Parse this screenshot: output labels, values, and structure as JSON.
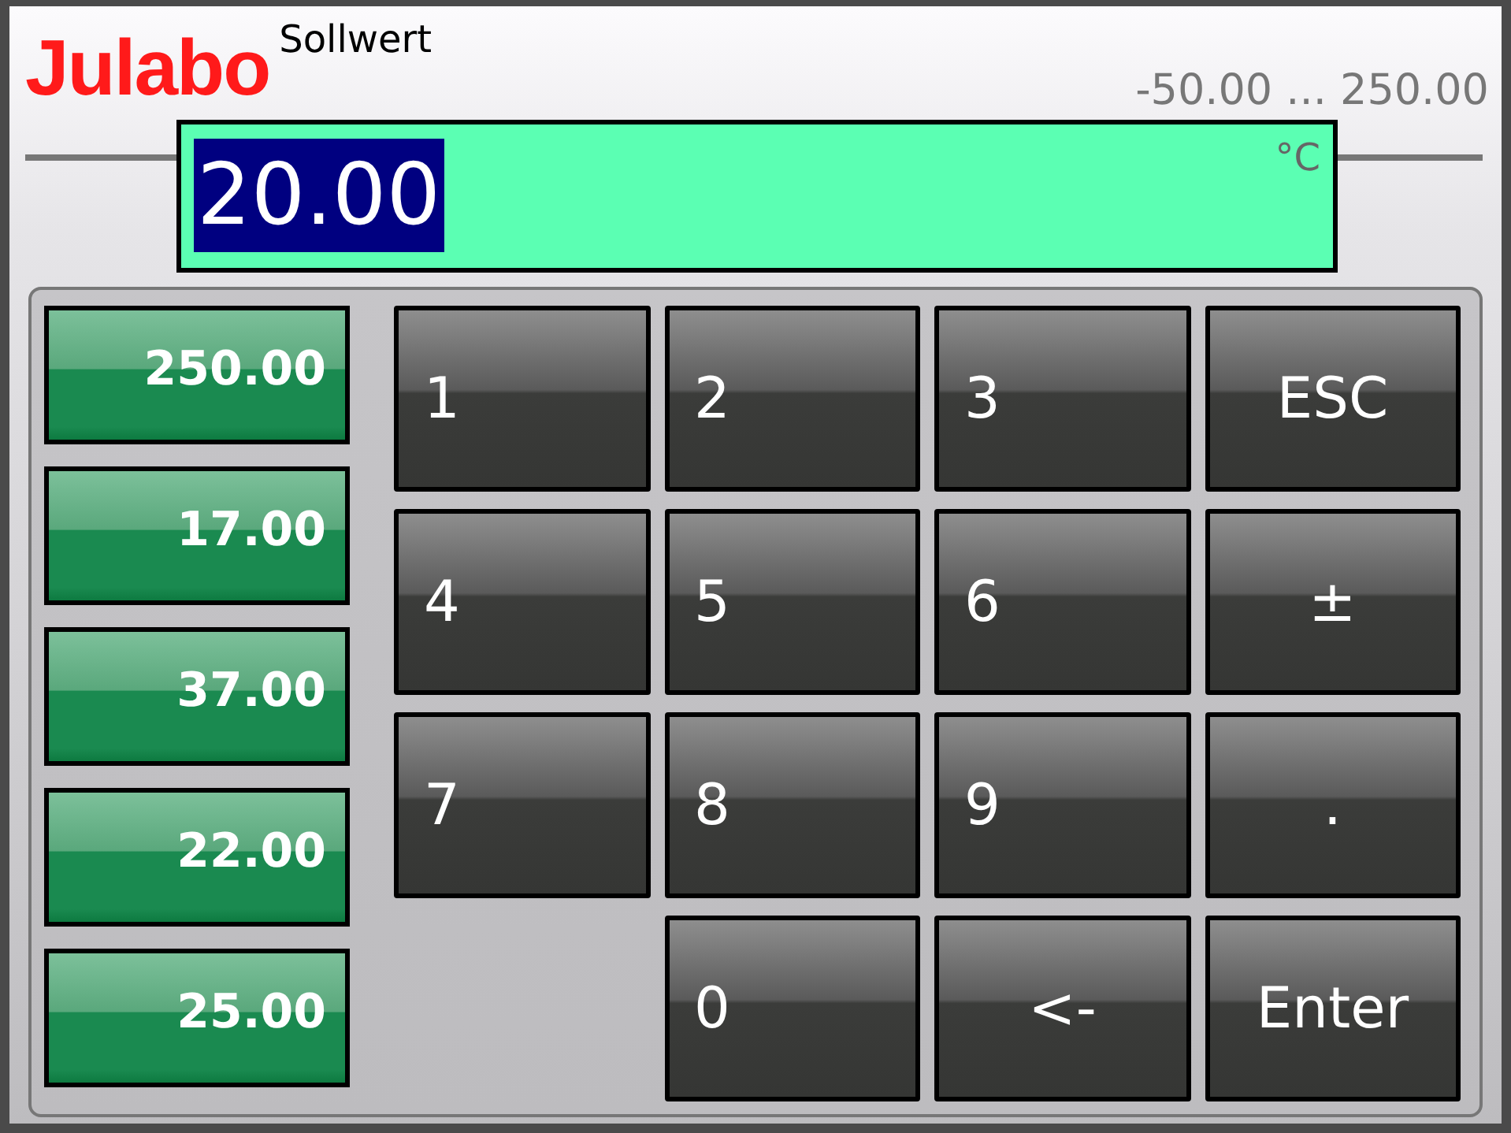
{
  "header": {
    "logo": "Julabo",
    "title": "Sollwert",
    "range": "-50.00 ... 250.00"
  },
  "display": {
    "value": "20.00",
    "selected": true,
    "unit": "°C"
  },
  "presets": [
    "250.00",
    "17.00",
    "37.00",
    "22.00",
    "25.00"
  ],
  "keys": [
    {
      "label": "1",
      "kind": "digit"
    },
    {
      "label": "2",
      "kind": "digit"
    },
    {
      "label": "3",
      "kind": "digit"
    },
    {
      "label": "ESC",
      "kind": "function"
    },
    {
      "label": "4",
      "kind": "digit"
    },
    {
      "label": "5",
      "kind": "digit"
    },
    {
      "label": "6",
      "kind": "digit"
    },
    {
      "label": "±",
      "kind": "function"
    },
    {
      "label": "7",
      "kind": "digit"
    },
    {
      "label": "8",
      "kind": "digit"
    },
    {
      "label": "9",
      "kind": "digit"
    },
    {
      "label": ".",
      "kind": "function"
    },
    {
      "label": "0",
      "kind": "digit"
    },
    {
      "label": "<-",
      "kind": "function"
    },
    {
      "label": "Enter",
      "kind": "function"
    }
  ]
}
